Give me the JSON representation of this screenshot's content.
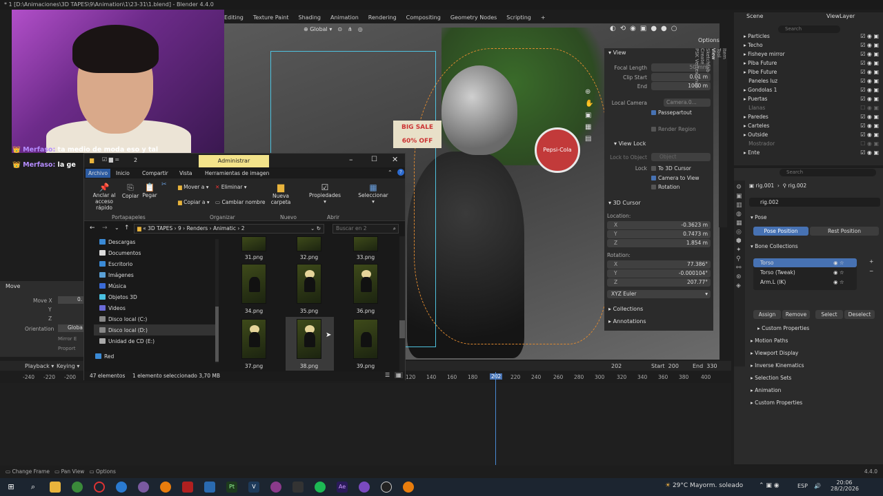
{
  "window": {
    "title": "* 1 [D:\\Animaciones\\3D TAPES\\9\\Animation\\1\\23-31\\1.blend] - Blender 4.4.0"
  },
  "workspaces": [
    "Editing",
    "Texture Paint",
    "Shading",
    "Animation",
    "Rendering",
    "Compositing",
    "Geometry Nodes",
    "Scripting"
  ],
  "viewport_toolbar": {
    "orientation": "Global",
    "options": "Options"
  },
  "viewport_signs": {
    "sale_top": "BIG SALE",
    "sale_bottom": "60% OFF",
    "circle": "Pepsi-Cola"
  },
  "npanel": {
    "view_header": "View",
    "focal_length_label": "Focal Length",
    "focal_length": "50 mm",
    "clip_start_label": "Clip Start",
    "clip_start": "0.01 m",
    "end_label": "End",
    "end": "1000 m",
    "local_camera_label": "Local Camera",
    "local_camera_value": "Camera.0...",
    "passepartout": "Passepartout",
    "render_region": "Render Region",
    "view_lock_header": "View Lock",
    "lock_to_object": "Lock to Object",
    "object_placeholder": "Object",
    "lock_label": "Lock",
    "to_3d_cursor": "To 3D Cursor",
    "camera_to_view": "Camera to View",
    "rotation": "Rotation",
    "cursor_header": "3D Cursor",
    "location_label": "Location:",
    "loc_x": "-0.3623 m",
    "loc_y": "0.7473 m",
    "loc_z": "1.854 m",
    "rotation_label": "Rotation:",
    "rot_x": "77.386°",
    "rot_y": "-0.000104°",
    "rot_z": "207.77°",
    "rot_mode": "XYZ Euler",
    "collections": "Collections",
    "annotations": "Annotations"
  },
  "side_tabs": [
    "Item",
    "Tool",
    "View",
    "Sketchfab",
    "Create",
    "PSK Vertex Snap"
  ],
  "outliner": {
    "scene": "Scene",
    "view_layer": "ViewLayer",
    "search_placeholder": "Search",
    "items": [
      {
        "label": "Particles",
        "dim": false
      },
      {
        "label": "Techo",
        "dim": false
      },
      {
        "label": "Fisheye mirror",
        "dim": false
      },
      {
        "label": "Piba Future",
        "dim": false
      },
      {
        "label": "Pibe Future",
        "dim": false
      },
      {
        "label": "Paneles luz",
        "dim": false
      },
      {
        "label": "Gondolas 1",
        "dim": false
      },
      {
        "label": "Puertas",
        "dim": false
      },
      {
        "label": "Llanas",
        "dim": true
      },
      {
        "label": "Paredes",
        "dim": false
      },
      {
        "label": "Carteles",
        "dim": false
      },
      {
        "label": "Outside",
        "dim": false
      },
      {
        "label": "Mostrador",
        "dim": true
      },
      {
        "label": "Ente",
        "dim": false
      }
    ]
  },
  "properties": {
    "search_placeholder": "Search",
    "breadcrumb_1": "rig.001",
    "breadcrumb_2": "rig.002",
    "object_name": "rig.002",
    "pose_header": "Pose",
    "pose_position": "Pose Position",
    "rest_position": "Rest Position",
    "bone_collections_header": "Bone Collections",
    "bone_collections": [
      "Torso",
      "Torso (Tweak)",
      "Arm.L (IK)"
    ],
    "assign": "Assign",
    "remove": "Remove",
    "select": "Select",
    "deselect": "Deselect",
    "custom_props_sub": "Custom Properties",
    "panels": [
      "Motion Paths",
      "Viewport Display",
      "Inverse Kinematics",
      "Selection Sets",
      "Animation",
      "Custom Properties"
    ]
  },
  "webcam": {
    "chat_1_name": "Merfaso:",
    "chat_1_text": " ta medio de moda eso y tal",
    "chat_2_name": "Merfaso:",
    "chat_2_text": " la ge"
  },
  "move_panel": {
    "title": "Move",
    "move_x": "Move X",
    "y": "Y",
    "z": "Z",
    "orientation_label": "Orientation",
    "orientation_value": "Globa",
    "mirror": "Mirror E",
    "proportional": "Proport",
    "move_x_value": "0."
  },
  "timeline": {
    "playback": "Playback",
    "keying": "Keying",
    "current_frame": "202",
    "start_label": "Start",
    "start": "200",
    "end_label": "End",
    "end": "330",
    "ticks_left": [
      "-240",
      "-220",
      "-200"
    ],
    "ticks_right": [
      "120",
      "140",
      "160",
      "180",
      "202",
      "220",
      "240",
      "260",
      "280",
      "300",
      "320",
      "340",
      "360",
      "380",
      "400"
    ]
  },
  "statusbar": {
    "change_frame": "Change Frame",
    "pan_view": "Pan View",
    "options": "Options",
    "version": "4.4.0"
  },
  "taskbar": {
    "weather": "29°C  Mayorm. soleado",
    "lang": "ESP",
    "time": "20:06",
    "date": "28/2/2026"
  },
  "explorer": {
    "title": "2",
    "admin_tab": "Administrar",
    "tabs": [
      "Archivo",
      "Inicio",
      "Compartir",
      "Vista",
      "Herramientas de imagen"
    ],
    "ribbon": {
      "pin": "Anclar al acceso rápido",
      "copy": "Copiar",
      "paste": "Pegar",
      "move_to": "Mover a",
      "copy_to": "Copiar a",
      "delete": "Eliminar",
      "rename": "Cambiar nombre",
      "new_folder": "Nueva carpeta",
      "properties": "Propiedades",
      "select": "Seleccionar",
      "group_clipboard": "Portapapeles",
      "group_organize": "Organizar",
      "group_new": "Nuevo",
      "group_open": "Abrir"
    },
    "breadcrumb": [
      "3D TAPES",
      "9",
      "Renders",
      "Animatic",
      "2"
    ],
    "search_placeholder": "Buscar en 2",
    "nav": [
      "Descargas",
      "Documentos",
      "Escritorio",
      "Imágenes",
      "Música",
      "Objetos 3D",
      "Videos",
      "Disco local (C:)",
      "Disco local (D:)",
      "Unidad de CD (E:)",
      "Red"
    ],
    "files": [
      "31.png",
      "32.png",
      "33.png",
      "34.png",
      "35.png",
      "36.png",
      "37.png",
      "38.png",
      "39.png"
    ],
    "status_count": "47 elementos",
    "status_selected": "1 elemento seleccionado  3,70 MB"
  }
}
